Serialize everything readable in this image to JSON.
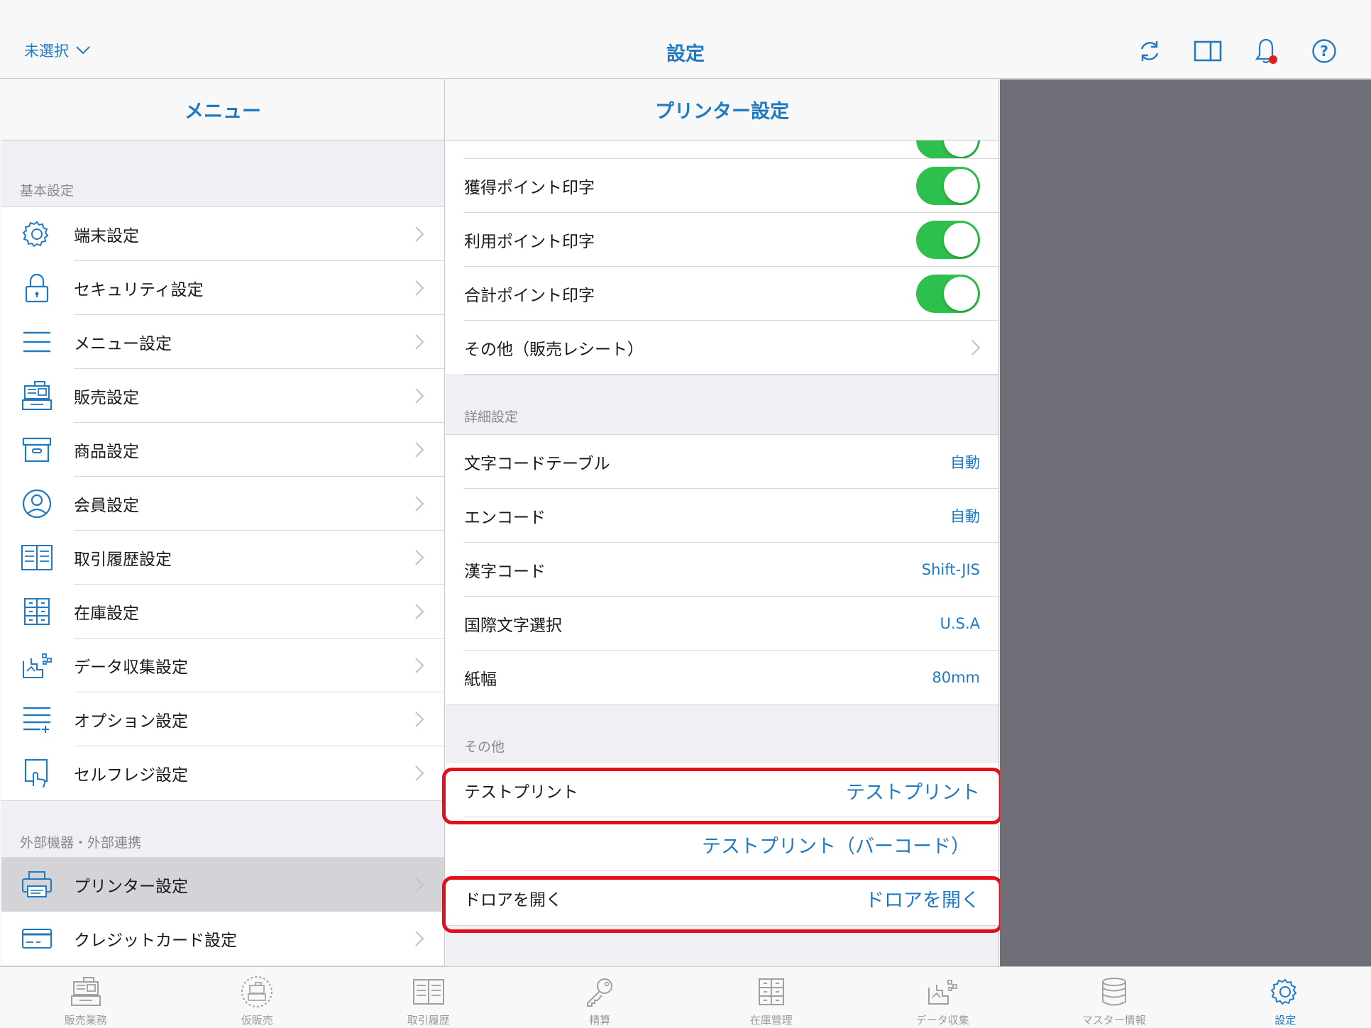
{
  "topbar": {
    "left_select": "未選択",
    "title": "設定",
    "icons": [
      "sync-icon",
      "split-view-icon",
      "bell-icon",
      "help-icon"
    ]
  },
  "menu": {
    "header": "メニュー",
    "section1": "基本設定",
    "items1": [
      {
        "label": "端末設定",
        "icon": "gear-icon"
      },
      {
        "label": "セキュリティ設定",
        "icon": "lock-icon"
      },
      {
        "label": "メニュー設定",
        "icon": "hamburger-icon"
      },
      {
        "label": "販売設定",
        "icon": "register-icon"
      },
      {
        "label": "商品設定",
        "icon": "box-icon"
      },
      {
        "label": "会員設定",
        "icon": "person-icon"
      },
      {
        "label": "取引履歴設定",
        "icon": "book-icon"
      },
      {
        "label": "在庫設定",
        "icon": "cabinet-icon"
      },
      {
        "label": "データ収集設定",
        "icon": "data-icon"
      },
      {
        "label": "オプション設定",
        "icon": "list-add-icon"
      },
      {
        "label": "セルフレジ設定",
        "icon": "self-register-icon"
      }
    ],
    "section2": "外部機器・外部連携",
    "items2": [
      {
        "label": "プリンター設定",
        "icon": "printer-icon",
        "selected": true
      },
      {
        "label": "クレジットカード設定",
        "icon": "credit-card-icon"
      }
    ]
  },
  "detail": {
    "header": "プリンター設定",
    "toggles": [
      {
        "label": "獲得ポイント印字",
        "on": true
      },
      {
        "label": "利用ポイント印字",
        "on": true
      },
      {
        "label": "合計ポイント印字",
        "on": true
      }
    ],
    "other_receipt": "その他（販売レシート）",
    "section_detail": "詳細設定",
    "detail_rows": [
      {
        "label": "文字コードテーブル",
        "value": "自動"
      },
      {
        "label": "エンコード",
        "value": "自動"
      },
      {
        "label": "漢字コード",
        "value": "Shift-JIS"
      },
      {
        "label": "国際文字選択",
        "value": "U.S.A"
      },
      {
        "label": "紙幅",
        "value": "80mm"
      }
    ],
    "section_other": "その他",
    "test_print": {
      "label": "テストプリント",
      "button": "テストプリント"
    },
    "test_print_barcode": "テストプリント（バーコード）",
    "drawer": {
      "label": "ドロアを開く",
      "button": "ドロアを開く"
    },
    "highlight_color": "#e3101a"
  },
  "tabbar": {
    "tabs": [
      {
        "label": "販売業務",
        "icon": "register-icon"
      },
      {
        "label": "仮販売",
        "icon": "temp-sale-icon"
      },
      {
        "label": "取引履歴",
        "icon": "book-icon"
      },
      {
        "label": "精算",
        "icon": "key-icon"
      },
      {
        "label": "在庫管理",
        "icon": "cabinet-icon"
      },
      {
        "label": "データ収集",
        "icon": "data-icon"
      },
      {
        "label": "マスター情報",
        "icon": "database-icon"
      },
      {
        "label": "設定",
        "icon": "gear-icon",
        "active": true
      }
    ]
  },
  "colors": {
    "accent": "#1f7ac2",
    "toggle_on": "#2ec04d",
    "right_pane": "#6f6f78"
  }
}
